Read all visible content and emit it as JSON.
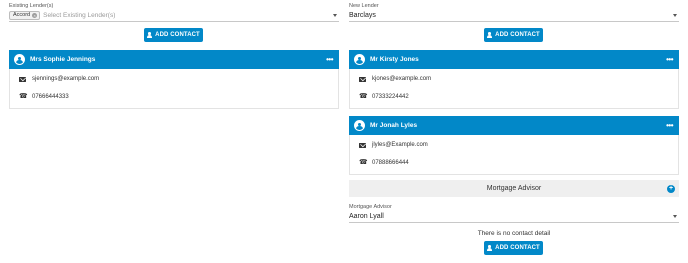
{
  "left": {
    "field_label": "Existing Lender(s)",
    "tag_label": "Accord",
    "placeholder": "Select Existing Lender(s)",
    "add_contact_label": "ADD CONTACT",
    "contacts": [
      {
        "name": "Mrs Sophie Jennings",
        "email": "sjennings@example.com",
        "phone": "07666444333"
      }
    ]
  },
  "right": {
    "field_label": "New Lender",
    "selected_value": "Barclays",
    "add_contact_label": "ADD CONTACT",
    "contacts": [
      {
        "name": "Mr Kirsty Jones",
        "email": "kjones@example.com",
        "phone": "07333224442"
      },
      {
        "name": "Mr Jonah Lyles",
        "email": "jlyles@Example.com",
        "phone": "07888666444"
      }
    ],
    "advisor_section_title": "Mortgage Advisor",
    "advisor_field_label": "Mortgage Advisor",
    "advisor_selected": "Aaron Lyall",
    "no_contact_text": "There is no contact detail",
    "add_contact_label_2": "ADD CONTACT"
  },
  "icons": {
    "avatar": "user-avatar-icon",
    "menu": "more-dots-icon",
    "email": "envelope-icon",
    "phone": "phone-icon",
    "add": "plus-circle-icon",
    "button_user": "user-icon"
  },
  "colors": {
    "accent": "#0288c8",
    "section_bg": "#efefef"
  }
}
